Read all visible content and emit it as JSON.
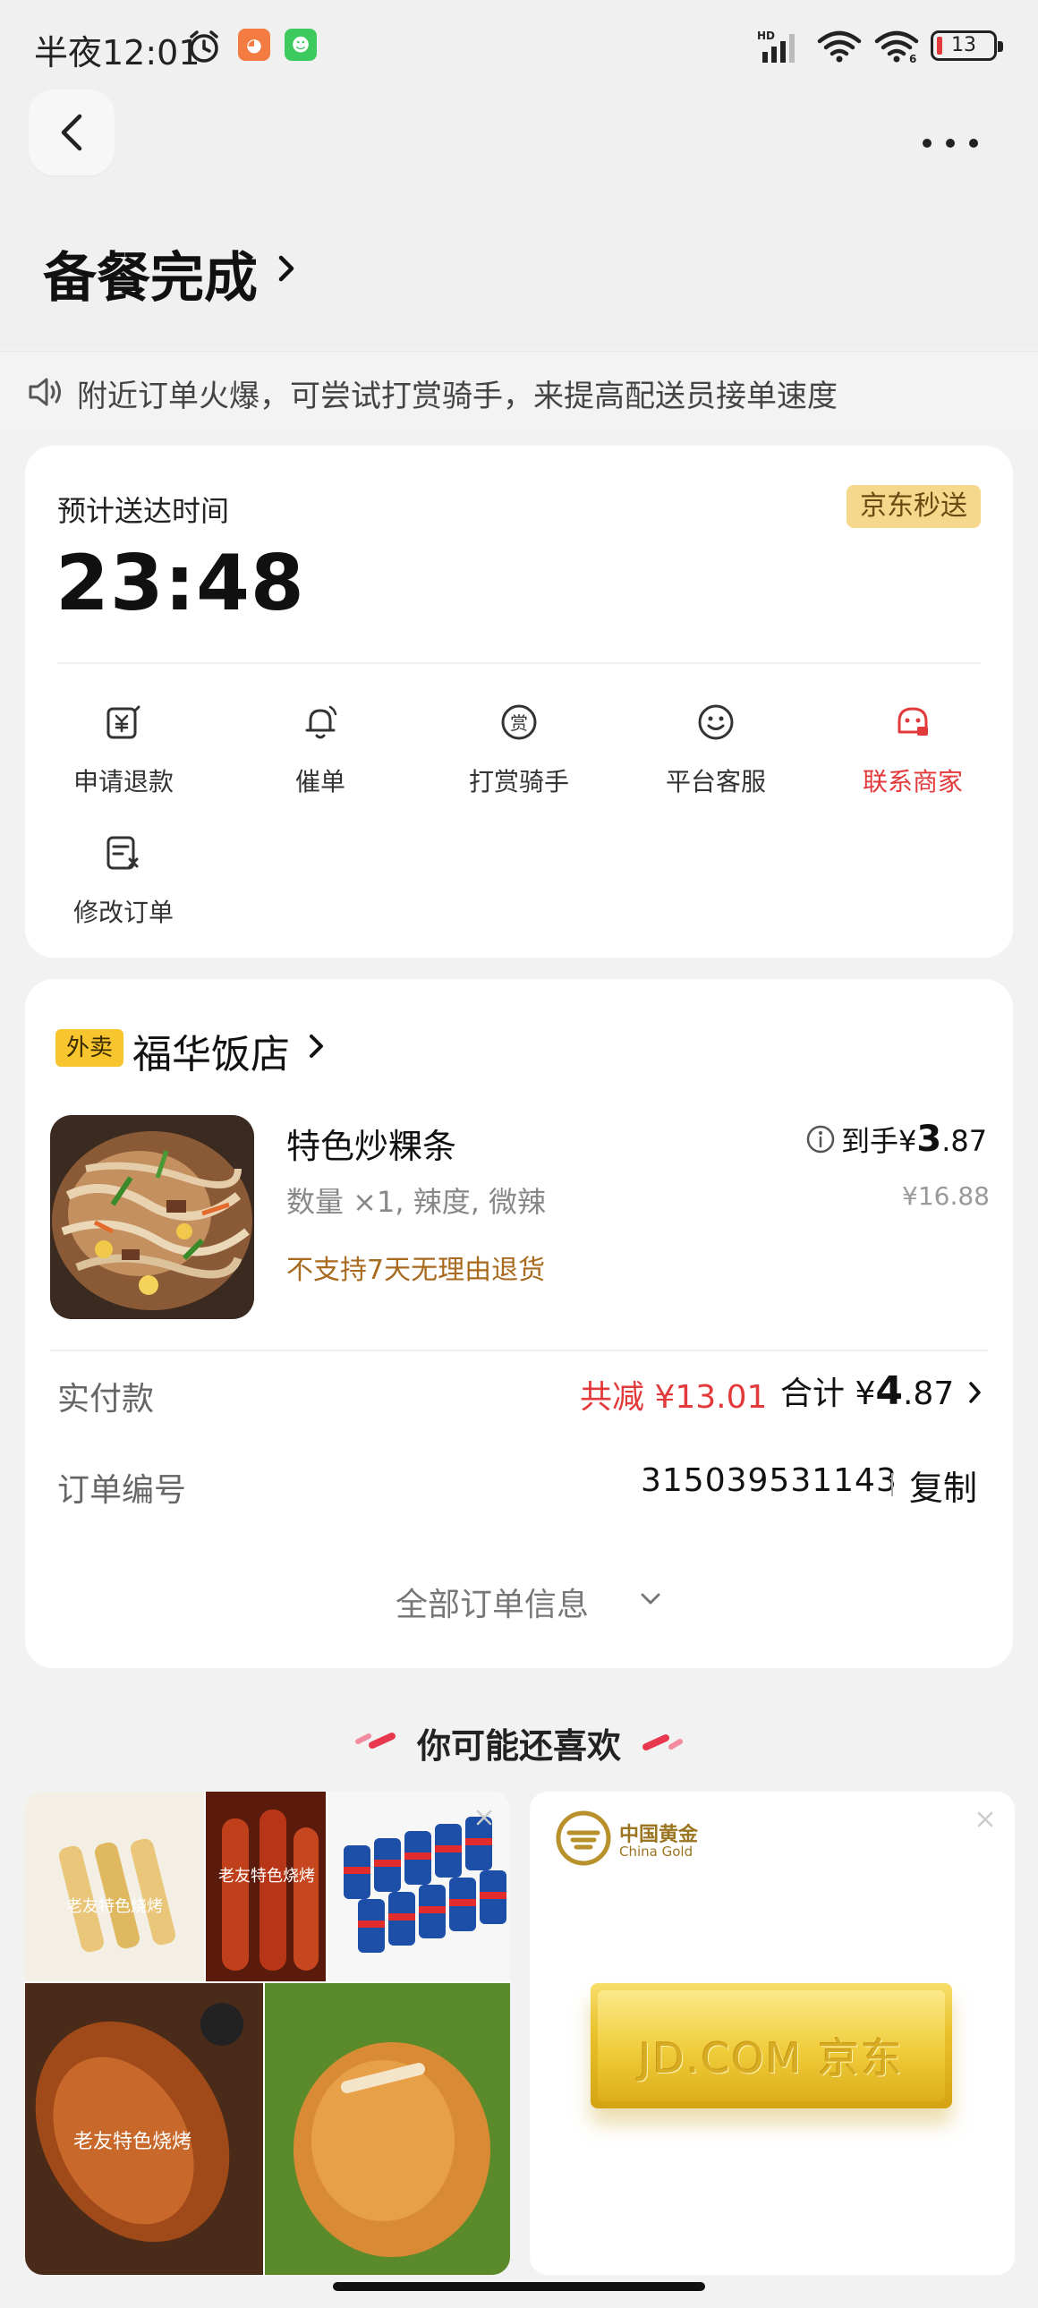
{
  "status_bar": {
    "time": "半夜12:01",
    "network": "HD",
    "battery": "13"
  },
  "header": {
    "title": "备餐完成"
  },
  "notice": {
    "text": "附近订单火爆，可尝试打赏骑手，来提高配送员接单速度"
  },
  "delivery": {
    "eta_label": "预计送达时间",
    "eta_time": "23:48",
    "badge": "京东秒送",
    "actions": [
      {
        "label": "申请退款",
        "icon": "refund-icon"
      },
      {
        "label": "催单",
        "icon": "bell-icon"
      },
      {
        "label": "打赏骑手",
        "icon": "reward-icon"
      },
      {
        "label": "平台客服",
        "icon": "smile-icon"
      },
      {
        "label": "联系商家",
        "icon": "merchant-icon",
        "color": "#e23a3a"
      },
      {
        "label": "修改订单",
        "icon": "edit-order-icon"
      }
    ]
  },
  "order": {
    "badge": "外卖",
    "shop_name": "福华饭店",
    "item": {
      "name": "特色炒粿条",
      "spec": "数量 ×1, 辣度, 微辣",
      "notice": "不支持7天无理由退货",
      "final_prefix": "到手¥",
      "final_int": "3",
      "final_dec": ".87",
      "original_price": "¥16.88"
    },
    "paid_label": "实付款",
    "discount": "共减 ¥13.01",
    "total_prefix": "合计 ¥",
    "total_int": "4",
    "total_dec": ".87",
    "number_label": "订单编号",
    "number": "315039531143",
    "copy_label": "复制",
    "all_info": "全部订单信息"
  },
  "recommend": {
    "title": "你可能还喜欢",
    "bbq_labels": [
      "老友特色烧烤",
      "老友特色烧烤",
      "老友特色烧烤"
    ],
    "gold_brand": "中国黄金",
    "gold_brand_en": "China Gold",
    "gold_bar_text": "JD.COM 京东"
  },
  "colors": {
    "accent_red": "#e23a3a",
    "badge_gold": "#f5d88c",
    "waimai_yellow": "#f7c52e",
    "notice_brown": "#a86a1e"
  }
}
